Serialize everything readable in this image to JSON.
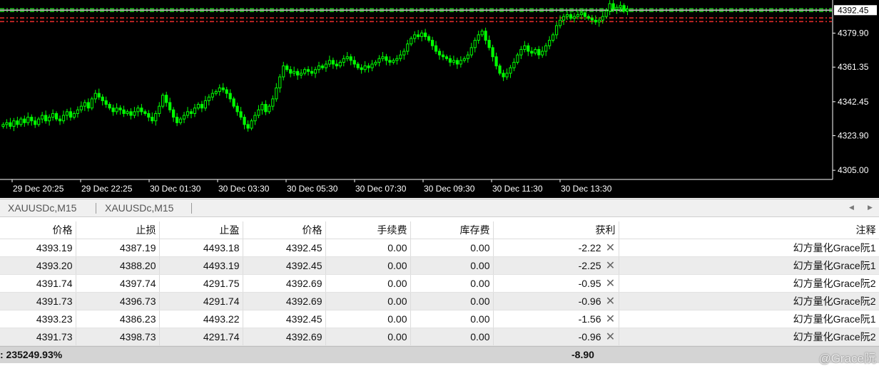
{
  "chart_data": {
    "type": "candlestick",
    "symbol": "XAUUSDc",
    "timeframe": "M15",
    "current_price": "4392.45",
    "price_ticks": [
      "4379.90",
      "4361.35",
      "4342.45",
      "4323.90",
      "4305.00"
    ],
    "time_ticks": [
      "29 Dec 20:25",
      "29 Dec 22:25",
      "30 Dec 01:30",
      "30 Dec 03:30",
      "30 Dec 05:30",
      "30 Dec 07:30",
      "30 Dec 09:30",
      "30 Dec 11:30",
      "30 Dec 13:30"
    ],
    "ylim": [
      4300,
      4398
    ],
    "close_series": [
      4330,
      4331,
      4329,
      4332,
      4330,
      4333,
      4331,
      4334,
      4332,
      4330,
      4333,
      4335,
      4332,
      4334,
      4336,
      4333,
      4332,
      4335,
      4337,
      4334,
      4336,
      4338,
      4340,
      4342,
      4339,
      4344,
      4347,
      4345,
      4343,
      4341,
      4339,
      4337,
      4339,
      4338,
      4336,
      4337,
      4335,
      4337,
      4339,
      4337,
      4336,
      4334,
      4332,
      4336,
      4340,
      4346,
      4342,
      4338,
      4334,
      4331,
      4333,
      4335,
      4337,
      4336,
      4339,
      4341,
      4339,
      4343,
      4345,
      4347,
      4348,
      4350,
      4349,
      4347,
      4344,
      4340,
      4337,
      4334,
      4330,
      4328,
      4332,
      4335,
      4338,
      4341,
      4337,
      4340,
      4344,
      4350,
      4356,
      4362,
      4360,
      4358,
      4359,
      4357,
      4358,
      4360,
      4359,
      4358,
      4360,
      4362,
      4361,
      4363,
      4365,
      4363,
      4362,
      4364,
      4366,
      4367,
      4365,
      4363,
      4361,
      4360,
      4362,
      4361,
      4363,
      4364,
      4366,
      4367,
      4365,
      4364,
      4365,
      4366,
      4368,
      4370,
      4374,
      4377,
      4379,
      4378,
      4380,
      4378,
      4376,
      4373,
      4370,
      4368,
      4367,
      4366,
      4364,
      4365,
      4363,
      4365,
      4366,
      4368,
      4372,
      4376,
      4379,
      4381,
      4376,
      4372,
      4367,
      4362,
      4358,
      4356,
      4358,
      4361,
      4364,
      4368,
      4371,
      4373,
      4370,
      4369,
      4371,
      4368,
      4370,
      4373,
      4376,
      4379,
      4384,
      4387,
      4389,
      4390,
      4388,
      4389,
      4390,
      4391,
      4389,
      4388,
      4387,
      4386,
      4387,
      4389,
      4392,
      4396,
      4393,
      4394,
      4395,
      4392,
      4393
    ],
    "lines": [
      {
        "name": "",
        "price": 4392.45,
        "color": "#c8c8c8",
        "style": "solid"
      },
      {
        "name": "",
        "price": 4393.2,
        "color": "#19c219",
        "style": "dashed"
      },
      {
        "name": "",
        "price": 4391.7,
        "color": "#19c219",
        "style": "dashed"
      },
      {
        "name": "",
        "price": 4388.2,
        "color": "#e02a2a",
        "style": "dashed"
      },
      {
        "name": "",
        "price": 4386.2,
        "color": "#e02a2a",
        "style": "dashed"
      }
    ],
    "candle_color": "#00ff00"
  },
  "tabs": [
    {
      "label": "XAUUSDc,M15"
    },
    {
      "label": "XAUUSDc,M15"
    }
  ],
  "table": {
    "columns": [
      "价格",
      "止损",
      "止盈",
      "价格",
      "手续费",
      "库存费",
      "获利",
      "注释"
    ],
    "rows": [
      [
        "4393.19",
        "4387.19",
        "4493.18",
        "4392.45",
        "0.00",
        "0.00",
        "-2.22",
        "幻方量化Grace阮1"
      ],
      [
        "4393.20",
        "4388.20",
        "4493.19",
        "4392.45",
        "0.00",
        "0.00",
        "-2.25",
        "幻方量化Grace阮1"
      ],
      [
        "4391.74",
        "4397.74",
        "4291.75",
        "4392.69",
        "0.00",
        "0.00",
        "-0.95",
        "幻方量化Grace阮2"
      ],
      [
        "4391.73",
        "4396.73",
        "4291.74",
        "4392.69",
        "0.00",
        "0.00",
        "-0.96",
        "幻方量化Grace阮2"
      ],
      [
        "4393.23",
        "4386.23",
        "4493.22",
        "4392.45",
        "0.00",
        "0.00",
        "-1.56",
        "幻方量化Grace阮1"
      ],
      [
        "4391.73",
        "4398.73",
        "4291.74",
        "4392.69",
        "0.00",
        "0.00",
        "-0.96",
        "幻方量化Grace阮2"
      ]
    ]
  },
  "summary": {
    "margin_level": ": 235249.93%",
    "total_profit": "-8.90"
  },
  "watermark": "@Grace阮"
}
